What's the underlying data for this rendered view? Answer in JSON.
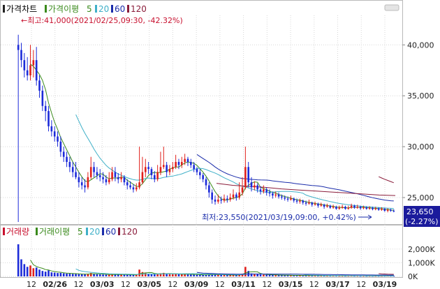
{
  "price_panel": {
    "title": "가격차트",
    "ma_label": "가격이평",
    "ma_periods": [
      "5",
      "20",
      "60",
      "120"
    ]
  },
  "volume_panel": {
    "title": "거래량",
    "ma_label": "거래이평",
    "ma_periods": [
      "5",
      "20",
      "60",
      "120"
    ]
  },
  "annotations": {
    "high_label": "←최고:41,000(2021/02/25,09:30, -42.32%)",
    "low_label": "최저:23,550(2021/03/19,09:00, +0.42%)",
    "low_arrow": "⟶"
  },
  "last_price": {
    "value": "23,650",
    "change": "(-2.27%)"
  },
  "colors": {
    "up": "#e0201c",
    "down": "#1c2bd9",
    "ma5": "#3a8a1c",
    "ma20": "#3fb0c8",
    "ma60": "#1a2caa",
    "ma120": "#8a1c3a",
    "panel_border": "#b9b9b9",
    "grid": "#d7d7d7",
    "last_price_bg": "#1b1b9c"
  },
  "chart_data": {
    "type": "candlestick",
    "price_axis": {
      "ticks": [
        "40,000",
        "35,000",
        "30,000",
        "25,000"
      ],
      "tick_values": [
        40000,
        35000,
        30000,
        25000
      ],
      "range": [
        22600,
        42900
      ]
    },
    "volume_axis": {
      "ticks": [
        "2,000K",
        "1,000K",
        "0K"
      ],
      "tick_values": [
        2000,
        1000,
        0
      ],
      "unit": "K",
      "range": [
        0,
        2600
      ]
    },
    "x_axis_labels": [
      "12",
      "02/26",
      "12",
      "03/03",
      "12",
      "03/05",
      "12",
      "03/09",
      "12",
      "03/11",
      "12",
      "03/15",
      "12",
      "03/17",
      "12",
      "03/19"
    ],
    "high": {
      "value": 41000,
      "date": "2021/02/25 09:30",
      "change_pct": -42.32
    },
    "low": {
      "value": 23550,
      "date": "2021/03/19 09:00",
      "change_pct": 0.42
    },
    "last": {
      "value": 23650,
      "change_pct": -2.27
    },
    "candles": [
      [
        40000,
        39500,
        41000,
        22600,
        2350
      ],
      [
        39500,
        38500,
        40200,
        37800,
        1250
      ],
      [
        38500,
        37500,
        39200,
        36800,
        900
      ],
      [
        37500,
        37000,
        38800,
        36500,
        700
      ],
      [
        37000,
        38000,
        40000,
        36500,
        800
      ],
      [
        38000,
        38500,
        39500,
        36800,
        600
      ],
      [
        38500,
        36500,
        39800,
        36000,
        650
      ],
      [
        36500,
        35500,
        37000,
        34800,
        500
      ],
      [
        35500,
        34000,
        36000,
        33500,
        400
      ],
      [
        34000,
        33500,
        34500,
        32500,
        350
      ],
      [
        33500,
        32000,
        34000,
        31500,
        450
      ],
      [
        32000,
        31500,
        32600,
        31000,
        300
      ],
      [
        31500,
        31000,
        32000,
        30500,
        280
      ],
      [
        31000,
        30500,
        31500,
        30000,
        250
      ],
      [
        30500,
        29500,
        31000,
        29000,
        260
      ],
      [
        29500,
        29000,
        30000,
        28500,
        230
      ],
      [
        29000,
        28500,
        29500,
        28000,
        210
      ],
      [
        28500,
        28000,
        29000,
        27500,
        200
      ],
      [
        28000,
        27500,
        28500,
        27000,
        190
      ],
      [
        27500,
        27000,
        28500,
        26800,
        180
      ],
      [
        27000,
        26500,
        27500,
        26000,
        170
      ],
      [
        26500,
        26200,
        27000,
        25800,
        160
      ],
      [
        26200,
        26000,
        26800,
        25500,
        155
      ],
      [
        26000,
        27000,
        27500,
        25800,
        200
      ],
      [
        27000,
        28000,
        29000,
        26800,
        250
      ],
      [
        28000,
        27500,
        28500,
        27000,
        180
      ],
      [
        27500,
        27200,
        28000,
        26800,
        160
      ],
      [
        27200,
        27000,
        27800,
        26600,
        150
      ],
      [
        27000,
        26800,
        27500,
        26400,
        140
      ],
      [
        26800,
        26500,
        27200,
        26200,
        130
      ],
      [
        26500,
        26800,
        27500,
        26300,
        140
      ],
      [
        26800,
        27500,
        28000,
        26600,
        160
      ],
      [
        27500,
        27000,
        28000,
        26600,
        150
      ],
      [
        27000,
        26800,
        27400,
        26400,
        140
      ],
      [
        26800,
        27000,
        27500,
        26500,
        130
      ],
      [
        27000,
        26500,
        27200,
        26200,
        125
      ],
      [
        26500,
        26200,
        26800,
        25800,
        120
      ],
      [
        26200,
        26000,
        26600,
        25800,
        110
      ],
      [
        26000,
        25800,
        26300,
        25500,
        115
      ],
      [
        25800,
        26000,
        26400,
        25600,
        120
      ],
      [
        26000,
        26500,
        30000,
        25800,
        500
      ],
      [
        26500,
        27500,
        29000,
        26300,
        320
      ],
      [
        27500,
        28000,
        28800,
        27000,
        250
      ],
      [
        28000,
        27800,
        28500,
        27300,
        200
      ],
      [
        27800,
        27200,
        28000,
        26800,
        170
      ],
      [
        27200,
        26800,
        27600,
        26500,
        160
      ],
      [
        26800,
        27500,
        28200,
        26600,
        180
      ],
      [
        27500,
        28000,
        29500,
        27200,
        230
      ],
      [
        28000,
        28200,
        30000,
        27800,
        260
      ],
      [
        28200,
        27500,
        28500,
        27000,
        200
      ],
      [
        27500,
        27800,
        28200,
        27200,
        170
      ],
      [
        27800,
        28000,
        28500,
        27500,
        160
      ],
      [
        28000,
        28500,
        29200,
        27800,
        190
      ],
      [
        28500,
        28200,
        28800,
        27800,
        170
      ],
      [
        28200,
        28500,
        29000,
        27900,
        160
      ],
      [
        28500,
        28800,
        29300,
        28200,
        170
      ],
      [
        28800,
        28500,
        29000,
        28100,
        150
      ],
      [
        28500,
        28200,
        28800,
        27900,
        140
      ],
      [
        28200,
        27800,
        28500,
        27500,
        130
      ],
      [
        27800,
        27500,
        28000,
        27200,
        120
      ],
      [
        27500,
        27200,
        27800,
        26800,
        115
      ],
      [
        27200,
        26800,
        27400,
        26500,
        110
      ],
      [
        26800,
        26200,
        27000,
        25800,
        120
      ],
      [
        26200,
        25500,
        26500,
        25000,
        150
      ],
      [
        25500,
        24800,
        25800,
        24400,
        160
      ],
      [
        24800,
        24600,
        25200,
        24300,
        130
      ],
      [
        24600,
        24800,
        25300,
        24400,
        120
      ],
      [
        24800,
        24700,
        25100,
        24400,
        110
      ],
      [
        24700,
        24900,
        25300,
        24500,
        110
      ],
      [
        24900,
        24800,
        25200,
        24500,
        100
      ],
      [
        24800,
        25000,
        25400,
        24600,
        100
      ],
      [
        25000,
        25300,
        25800,
        24800,
        110
      ],
      [
        25300,
        25000,
        25500,
        24700,
        100
      ],
      [
        25000,
        25500,
        26500,
        24800,
        150
      ],
      [
        25500,
        26000,
        27000,
        25200,
        200
      ],
      [
        26000,
        28000,
        30000,
        25800,
        700
      ],
      [
        28000,
        26500,
        28500,
        26000,
        400
      ],
      [
        26500,
        26000,
        27000,
        25600,
        220
      ],
      [
        26000,
        26200,
        26600,
        25700,
        180
      ],
      [
        26200,
        25800,
        26400,
        25500,
        160
      ],
      [
        25800,
        25600,
        26100,
        25300,
        140
      ],
      [
        25600,
        25800,
        26200,
        25400,
        130
      ],
      [
        25800,
        25500,
        26000,
        25200,
        120
      ],
      [
        25500,
        25400,
        25800,
        25100,
        110
      ],
      [
        25400,
        25200,
        25600,
        24900,
        100
      ],
      [
        25200,
        25300,
        25600,
        25000,
        95
      ],
      [
        25300,
        25100,
        25500,
        24900,
        90
      ],
      [
        25100,
        25000,
        25300,
        24800,
        85
      ],
      [
        25000,
        24900,
        25200,
        24700,
        80
      ],
      [
        24900,
        24800,
        25100,
        24600,
        80
      ],
      [
        24800,
        24900,
        25200,
        24700,
        75
      ],
      [
        24900,
        24700,
        25000,
        24500,
        75
      ],
      [
        24700,
        24600,
        24900,
        24400,
        70
      ],
      [
        24600,
        24700,
        24900,
        24400,
        70
      ],
      [
        24700,
        24500,
        24800,
        24300,
        65
      ],
      [
        24500,
        24400,
        24700,
        24200,
        65
      ],
      [
        24400,
        24500,
        24800,
        24300,
        60
      ],
      [
        24500,
        24300,
        24600,
        24100,
        60
      ],
      [
        24300,
        24400,
        24600,
        24200,
        60
      ],
      [
        24400,
        24200,
        24500,
        24000,
        55
      ],
      [
        24200,
        24300,
        24500,
        24100,
        55
      ],
      [
        24300,
        24100,
        24400,
        23900,
        55
      ],
      [
        24100,
        24200,
        24400,
        24000,
        50
      ],
      [
        24200,
        24000,
        24300,
        23900,
        50
      ],
      [
        24000,
        24100,
        24300,
        23900,
        50
      ],
      [
        24100,
        23900,
        24200,
        23800,
        50
      ],
      [
        23900,
        24000,
        24200,
        23800,
        45
      ],
      [
        24000,
        24100,
        24300,
        23900,
        45
      ],
      [
        24100,
        23900,
        24200,
        23800,
        45
      ],
      [
        23900,
        24000,
        24200,
        23800,
        45
      ],
      [
        24000,
        24200,
        24400,
        23900,
        50
      ],
      [
        24200,
        24000,
        24300,
        23900,
        45
      ],
      [
        24000,
        24100,
        24300,
        23900,
        45
      ],
      [
        24100,
        23950,
        24200,
        23800,
        40
      ],
      [
        23950,
        24050,
        24200,
        23850,
        40
      ],
      [
        24050,
        23900,
        24150,
        23800,
        40
      ],
      [
        23900,
        24000,
        24150,
        23800,
        40
      ],
      [
        24000,
        23850,
        24100,
        23750,
        40
      ],
      [
        23850,
        23950,
        24100,
        23750,
        40
      ],
      [
        23950,
        23800,
        24050,
        23700,
        40
      ],
      [
        23800,
        23900,
        24050,
        23700,
        40
      ],
      [
        23900,
        23700,
        24000,
        23600,
        45
      ],
      [
        23700,
        23800,
        23950,
        23550,
        50
      ],
      [
        23800,
        23700,
        23900,
        23600,
        45
      ],
      [
        23700,
        23650,
        23850,
        23550,
        45
      ]
    ],
    "ma_price_line": {
      "name": "",
      "values": [
        24900,
        24700,
        24600,
        24500,
        24350,
        24250,
        24150,
        24050,
        23950,
        23850,
        23750,
        23700
      ]
    }
  }
}
